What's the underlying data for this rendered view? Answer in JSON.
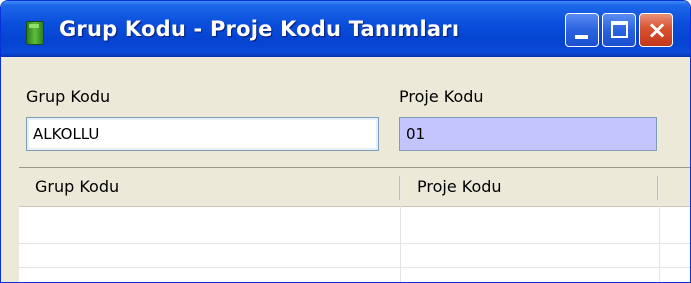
{
  "window": {
    "title": "Grup Kodu - Proje Kodu Tanımları",
    "app_icon": "green-document-icon",
    "controls": {
      "minimize": "minimize-icon",
      "maximize": "maximize-icon",
      "close": "×"
    }
  },
  "form": {
    "grup_kodu_label": "Grup Kodu",
    "grup_kodu_value": "ALKOLLU",
    "proje_kodu_label": "Proje Kodu",
    "proje_kodu_value": "01"
  },
  "grid": {
    "columns": [
      "Grup Kodu",
      "Proje Kodu"
    ],
    "rows": []
  },
  "colors": {
    "title_bar": "#0543d1",
    "window_bg": "#ece9d8",
    "proje_field_bg": "#c4c4ff",
    "close_button": "#d9532f"
  }
}
